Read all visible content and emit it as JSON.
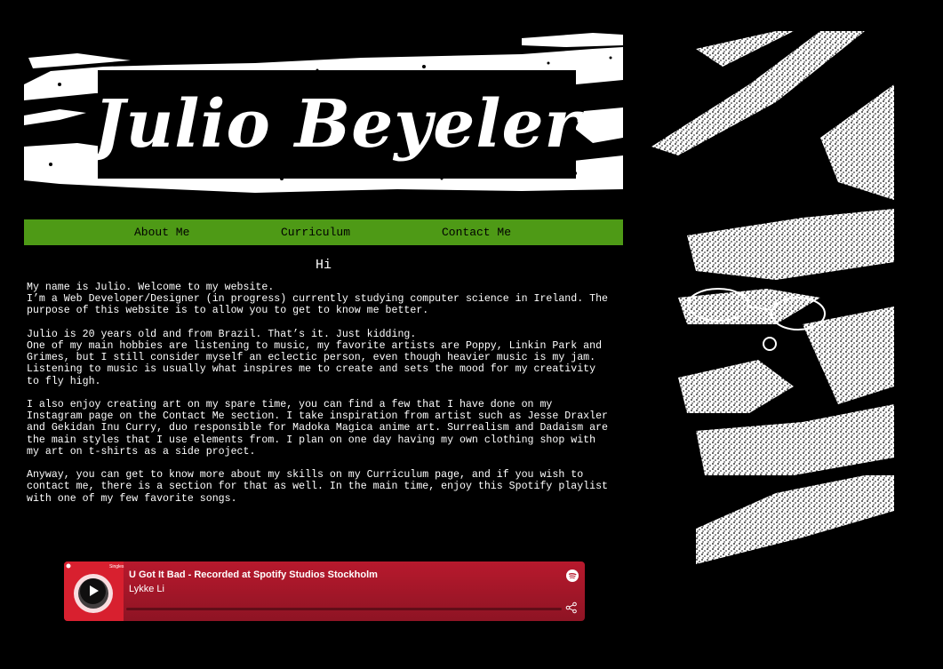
{
  "header": {
    "title": "Julio Beyeler"
  },
  "nav": {
    "items": [
      {
        "label": "About Me"
      },
      {
        "label": "Curriculum"
      },
      {
        "label": "Contact Me"
      }
    ]
  },
  "main": {
    "heading": "Hi",
    "paragraphs": [
      [
        "My name is Julio. Welcome to my website.",
        "I’m a Web Developer/Designer (in progress) currently studying computer science in Ireland. The",
        "purpose of this website is to allow you to get to know me better."
      ],
      [
        "Julio is 20 years old and from Brazil. That’s it. Just kidding.",
        "One of my main hobbies are listening to music, my favorite artists are Poppy, Linkin Park and",
        "Grimes, but I still consider myself an eclectic person, even though heavier music is my jam.",
        "Listening to music is usually what inspires me to create and sets the mood for my creativity",
        "to fly high."
      ],
      [
        "I also enjoy creating art on my spare time, you can find a few that I have done on my",
        "Instagram page on the Contact Me section. I take inspiration from artist such as Jesse Draxler",
        "and Gekidan Inu Curry, duo responsible for Madoka Magica anime art. Surrealism and Dadaism are",
        "the main styles that I use elements from. I plan on one day having my own clothing shop with",
        "my art on t-shirts as a side project."
      ],
      [
        "Anyway, you can get to know more about my skills on my Curriculum page, and if you wish to",
        "contact me, there is a section for that as well. In the main time, enjoy this Spotify playlist",
        "with one of my few favorite songs."
      ]
    ]
  },
  "player": {
    "cover_tag": "Singles",
    "track_title": "U Got It Bad - Recorded at Spotify Studios Stockholm",
    "artist": "Lykke Li",
    "icons": {
      "play": "play-icon",
      "brand": "spotify-icon",
      "share": "share-icon"
    },
    "colors": {
      "background": "#b8192d",
      "cover": "#d8202f"
    }
  },
  "colors": {
    "nav_background": "#4e9a16",
    "page_background": "#000000"
  }
}
